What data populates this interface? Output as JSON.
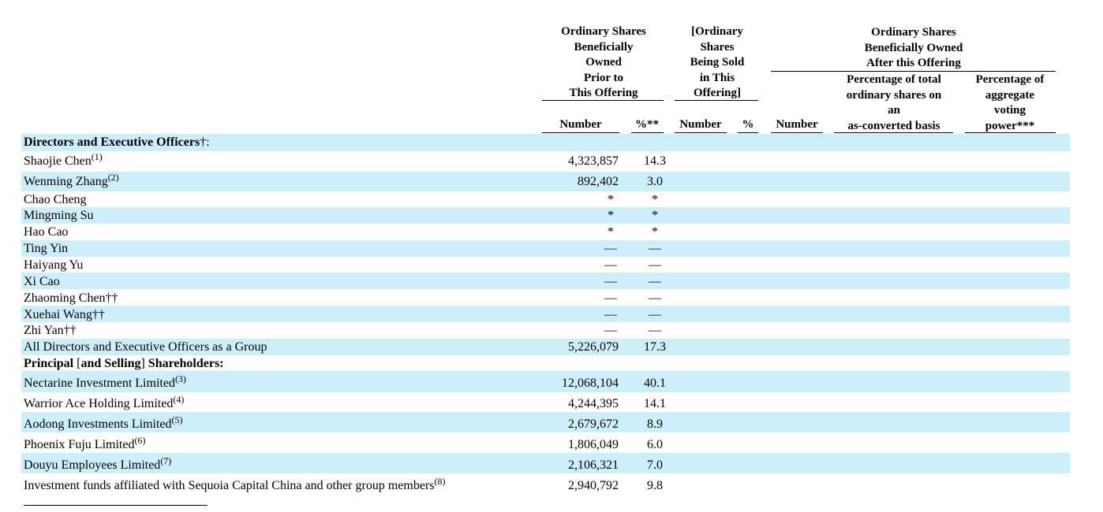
{
  "headers": {
    "prior": "Ordinary Shares\nBeneficially\nOwned\nPrior to\nThis Offering",
    "sold": "[Ordinary\nShares\nBeing Sold\nin This\nOffering]",
    "after": "Ordinary Shares\nBeneficially Owned\nAfter this Offering",
    "pct_total": "Percentage of total\nordinary shares on\nan\nas-converted basis",
    "pct_voting": "Percentage of\naggregate\nvoting\npower***",
    "col_number_prior": "Number",
    "col_pct_prior": "%**",
    "col_number_sold": "Number",
    "col_pct_sold": "%",
    "col_number_after": "Number"
  },
  "sections": {
    "directors": {
      "label": "Directors and Executive Officers",
      "suffix": "†:"
    },
    "principal": {
      "label_bold1": "Principal ",
      "label_plain": "[",
      "label_bold2": "and Selling",
      "label_plain2": "] ",
      "label_bold3": "Shareholders:"
    }
  },
  "rows": [
    {
      "name": "Shaojie Chen",
      "note": "(1)",
      "number": "4,323,857",
      "pct": "14.3"
    },
    {
      "name": "Wenming Zhang",
      "note": "(2)",
      "number": "892,402",
      "pct": "3.0"
    },
    {
      "name": "Chao Cheng",
      "note": "",
      "number": "*",
      "pct": "*"
    },
    {
      "name": "Mingming Su",
      "note": "",
      "number": "*",
      "pct": "*"
    },
    {
      "name": "Hao Cao",
      "note": "",
      "number": "*",
      "pct": "*"
    },
    {
      "name": "Ting Yin",
      "note": "",
      "number": "—",
      "pct": "—"
    },
    {
      "name": "Haiyang Yu",
      "note": "",
      "number": "—",
      "pct": "—"
    },
    {
      "name": "Xi Cao",
      "note": "",
      "number": "—",
      "pct": "—"
    },
    {
      "name": "Zhaoming Chen††",
      "note": "",
      "number": "—",
      "pct": "—"
    },
    {
      "name": "Xuehai Wang††",
      "note": "",
      "number": "—",
      "pct": "—"
    },
    {
      "name": "Zhi Yan††",
      "note": "",
      "number": "—",
      "pct": "—"
    },
    {
      "name": "All Directors and Executive Officers as a Group",
      "note": "",
      "number": "5,226,079",
      "pct": "17.3"
    },
    {
      "name": "Nectarine Investment Limited",
      "note": "(3)",
      "number": "12,068,104",
      "pct": "40.1"
    },
    {
      "name": "Warrior Ace Holding Limited",
      "note": "(4)",
      "number": "4,244,395",
      "pct": "14.1"
    },
    {
      "name": "Aodong Investments Limited",
      "note": "(5)",
      "number": "2,679,672",
      "pct": "8.9"
    },
    {
      "name": "Phoenix Fuju Limited",
      "note": "(6)",
      "number": "1,806,049",
      "pct": "6.0"
    },
    {
      "name": "Douyu Employees Limited",
      "note": "(7)",
      "number": "2,106,321",
      "pct": "7.0"
    },
    {
      "name": "Investment funds affiliated with Sequoia Capital China and other group members",
      "note": "(8)",
      "number": "2,940,792",
      "pct": "9.8"
    }
  ]
}
